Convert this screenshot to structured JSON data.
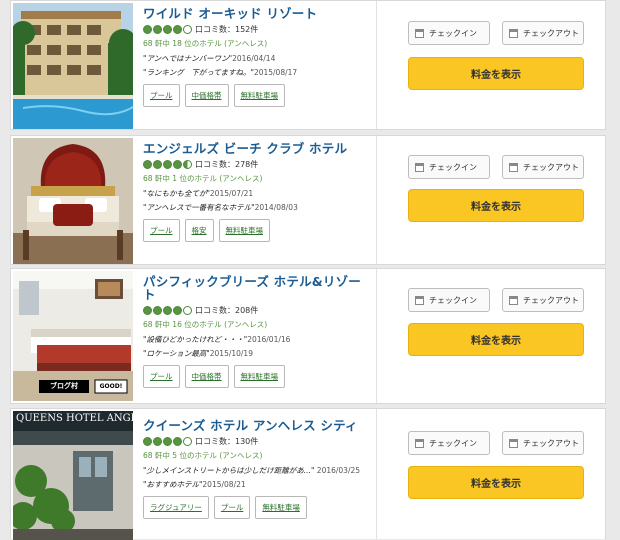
{
  "buttons": {
    "checkin": "チェックイン",
    "checkout": "チェックアウト",
    "price": "料金を表示"
  },
  "hotels": [
    {
      "name": "ワイルド オーキッド リゾート",
      "rating": 4,
      "reviews": "口コミ数：152件",
      "rank": "68 軒中 18 位のホテル (アンヘレス)",
      "quotes": [
        {
          "text": "\"アンヘではナンバーワン\"",
          "date": "2016/04/14"
        },
        {
          "text": "\"ランキング　下がってますね。\"",
          "date": "2015/08/17"
        }
      ],
      "tags": [
        "プール",
        "中価格帯",
        "無料駐車場"
      ]
    },
    {
      "name": "エンジェルズ ビーチ クラブ ホテル",
      "rating": 4.5,
      "reviews": "口コミ数：278件",
      "rank": "68 軒中 1 位のホテル (アンヘレス)",
      "quotes": [
        {
          "text": "\"なにもかも全てが\"",
          "date": "2015/07/21"
        },
        {
          "text": "\"アンヘレスで一番有名なホテル\"",
          "date": "2014/08/03"
        }
      ],
      "tags": [
        "プール",
        "格安",
        "無料駐車場"
      ]
    },
    {
      "name": "パシフィックブリーズ ホテル&リゾート",
      "rating": 4,
      "reviews": "口コミ数：208件",
      "rank": "68 軒中 16 位のホテル (アンヘレス)",
      "quotes": [
        {
          "text": "\"設備ひどかったけれど・・・\"",
          "date": "2016/01/16"
        },
        {
          "text": "\"ロケーション最高\"",
          "date": "2015/10/19"
        }
      ],
      "tags": [
        "プール",
        "中価格帯",
        "無料駐車場"
      ],
      "badge": {
        "left": "ブログ村",
        "right": "GOOD!"
      }
    },
    {
      "name": "クイーンズ ホテル アンヘレス シティ",
      "rating": 4,
      "reviews": "口コミ数：130件",
      "rank": "68 軒中 5 位のホテル (アンヘレス)",
      "quotes": [
        {
          "text": "\"少しメインストリートからは少しだけ距離があ...\"",
          "date": "2016/03/25"
        },
        {
          "text": "\"おすすめホテル\"",
          "date": "2015/08/21"
        }
      ],
      "tags": [
        "ラグジュアリー",
        "プール",
        "無料駐車場"
      ],
      "sign": "QUEENS HOTEL ANGE"
    }
  ]
}
